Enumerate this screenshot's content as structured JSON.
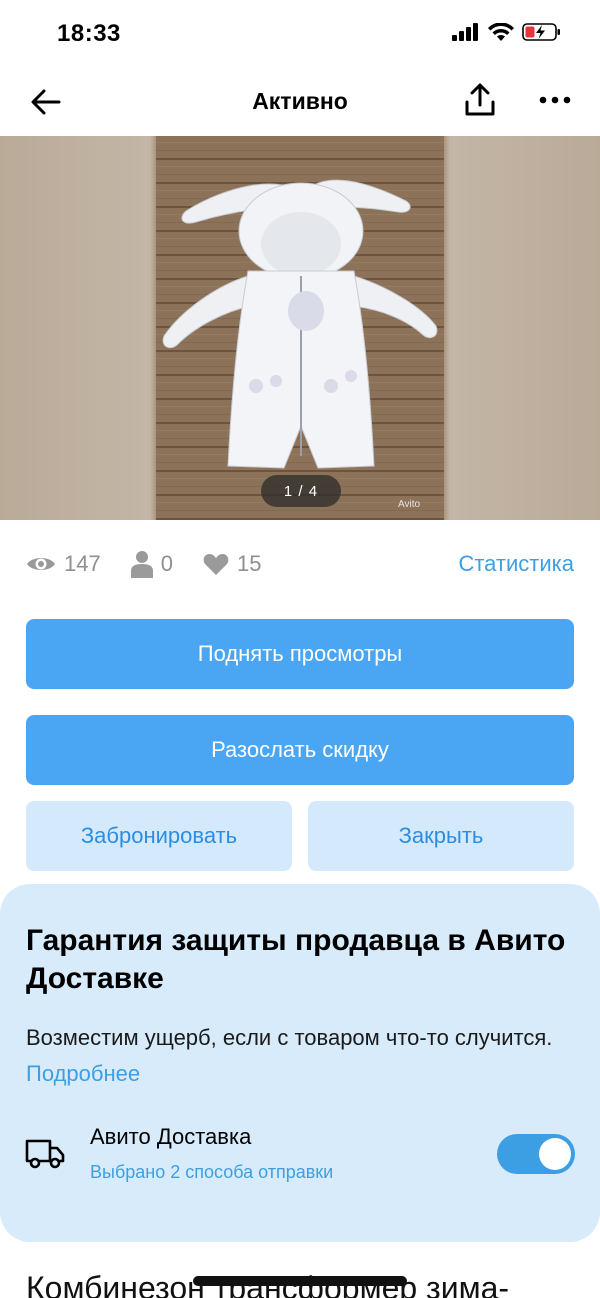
{
  "status_bar": {
    "time": "18:33"
  },
  "nav": {
    "title": "Активно"
  },
  "gallery": {
    "counter": "1 / 4",
    "watermark": "Avito"
  },
  "stats": {
    "views": "147",
    "contacts": "0",
    "favorites": "15",
    "link": "Статистика"
  },
  "actions": {
    "raise_views": "Поднять просмотры",
    "send_discount": "Разослать скидку",
    "reserve": "Забронировать",
    "close": "Закрыть"
  },
  "promo": {
    "title": "Гарантия защиты продавца в Авито Доставке",
    "text": "Возместим ущерб, если с товаром что-то случится.",
    "link": "Подробнее",
    "delivery_label": "Авито Доставка",
    "delivery_sub": "Выбрано 2 способа отправки",
    "delivery_enabled": true
  },
  "item": {
    "title": "Комбинезон трансформер зима-"
  },
  "colors": {
    "accent": "#4aa6f2",
    "link": "#3d9fe3",
    "card": "#d8ebfb",
    "secondary_button": "#d4e9fb"
  }
}
